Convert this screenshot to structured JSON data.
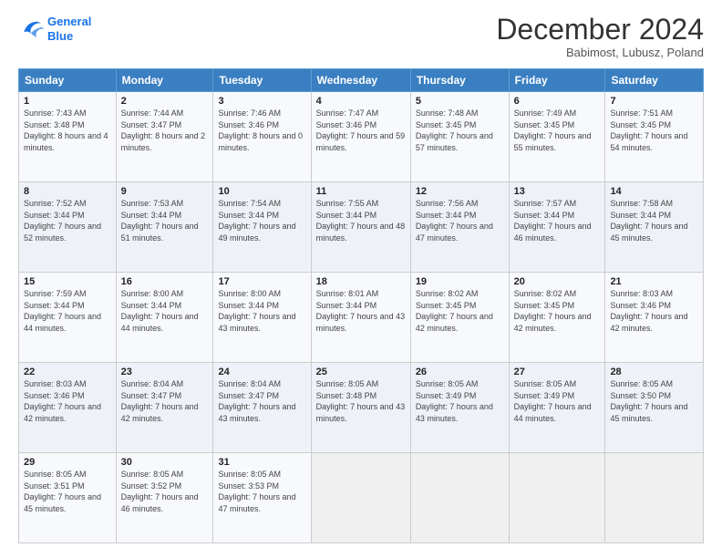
{
  "logo": {
    "line1": "General",
    "line2": "Blue"
  },
  "title": "December 2024",
  "location": "Babimost, Lubusz, Poland",
  "days_header": [
    "Sunday",
    "Monday",
    "Tuesday",
    "Wednesday",
    "Thursday",
    "Friday",
    "Saturday"
  ],
  "weeks": [
    [
      {
        "day": "1",
        "sunrise": "Sunrise: 7:43 AM",
        "sunset": "Sunset: 3:48 PM",
        "daylight": "Daylight: 8 hours and 4 minutes."
      },
      {
        "day": "2",
        "sunrise": "Sunrise: 7:44 AM",
        "sunset": "Sunset: 3:47 PM",
        "daylight": "Daylight: 8 hours and 2 minutes."
      },
      {
        "day": "3",
        "sunrise": "Sunrise: 7:46 AM",
        "sunset": "Sunset: 3:46 PM",
        "daylight": "Daylight: 8 hours and 0 minutes."
      },
      {
        "day": "4",
        "sunrise": "Sunrise: 7:47 AM",
        "sunset": "Sunset: 3:46 PM",
        "daylight": "Daylight: 7 hours and 59 minutes."
      },
      {
        "day": "5",
        "sunrise": "Sunrise: 7:48 AM",
        "sunset": "Sunset: 3:45 PM",
        "daylight": "Daylight: 7 hours and 57 minutes."
      },
      {
        "day": "6",
        "sunrise": "Sunrise: 7:49 AM",
        "sunset": "Sunset: 3:45 PM",
        "daylight": "Daylight: 7 hours and 55 minutes."
      },
      {
        "day": "7",
        "sunrise": "Sunrise: 7:51 AM",
        "sunset": "Sunset: 3:45 PM",
        "daylight": "Daylight: 7 hours and 54 minutes."
      }
    ],
    [
      {
        "day": "8",
        "sunrise": "Sunrise: 7:52 AM",
        "sunset": "Sunset: 3:44 PM",
        "daylight": "Daylight: 7 hours and 52 minutes."
      },
      {
        "day": "9",
        "sunrise": "Sunrise: 7:53 AM",
        "sunset": "Sunset: 3:44 PM",
        "daylight": "Daylight: 7 hours and 51 minutes."
      },
      {
        "day": "10",
        "sunrise": "Sunrise: 7:54 AM",
        "sunset": "Sunset: 3:44 PM",
        "daylight": "Daylight: 7 hours and 49 minutes."
      },
      {
        "day": "11",
        "sunrise": "Sunrise: 7:55 AM",
        "sunset": "Sunset: 3:44 PM",
        "daylight": "Daylight: 7 hours and 48 minutes."
      },
      {
        "day": "12",
        "sunrise": "Sunrise: 7:56 AM",
        "sunset": "Sunset: 3:44 PM",
        "daylight": "Daylight: 7 hours and 47 minutes."
      },
      {
        "day": "13",
        "sunrise": "Sunrise: 7:57 AM",
        "sunset": "Sunset: 3:44 PM",
        "daylight": "Daylight: 7 hours and 46 minutes."
      },
      {
        "day": "14",
        "sunrise": "Sunrise: 7:58 AM",
        "sunset": "Sunset: 3:44 PM",
        "daylight": "Daylight: 7 hours and 45 minutes."
      }
    ],
    [
      {
        "day": "15",
        "sunrise": "Sunrise: 7:59 AM",
        "sunset": "Sunset: 3:44 PM",
        "daylight": "Daylight: 7 hours and 44 minutes."
      },
      {
        "day": "16",
        "sunrise": "Sunrise: 8:00 AM",
        "sunset": "Sunset: 3:44 PM",
        "daylight": "Daylight: 7 hours and 44 minutes."
      },
      {
        "day": "17",
        "sunrise": "Sunrise: 8:00 AM",
        "sunset": "Sunset: 3:44 PM",
        "daylight": "Daylight: 7 hours and 43 minutes."
      },
      {
        "day": "18",
        "sunrise": "Sunrise: 8:01 AM",
        "sunset": "Sunset: 3:44 PM",
        "daylight": "Daylight: 7 hours and 43 minutes."
      },
      {
        "day": "19",
        "sunrise": "Sunrise: 8:02 AM",
        "sunset": "Sunset: 3:45 PM",
        "daylight": "Daylight: 7 hours and 42 minutes."
      },
      {
        "day": "20",
        "sunrise": "Sunrise: 8:02 AM",
        "sunset": "Sunset: 3:45 PM",
        "daylight": "Daylight: 7 hours and 42 minutes."
      },
      {
        "day": "21",
        "sunrise": "Sunrise: 8:03 AM",
        "sunset": "Sunset: 3:46 PM",
        "daylight": "Daylight: 7 hours and 42 minutes."
      }
    ],
    [
      {
        "day": "22",
        "sunrise": "Sunrise: 8:03 AM",
        "sunset": "Sunset: 3:46 PM",
        "daylight": "Daylight: 7 hours and 42 minutes."
      },
      {
        "day": "23",
        "sunrise": "Sunrise: 8:04 AM",
        "sunset": "Sunset: 3:47 PM",
        "daylight": "Daylight: 7 hours and 42 minutes."
      },
      {
        "day": "24",
        "sunrise": "Sunrise: 8:04 AM",
        "sunset": "Sunset: 3:47 PM",
        "daylight": "Daylight: 7 hours and 43 minutes."
      },
      {
        "day": "25",
        "sunrise": "Sunrise: 8:05 AM",
        "sunset": "Sunset: 3:48 PM",
        "daylight": "Daylight: 7 hours and 43 minutes."
      },
      {
        "day": "26",
        "sunrise": "Sunrise: 8:05 AM",
        "sunset": "Sunset: 3:49 PM",
        "daylight": "Daylight: 7 hours and 43 minutes."
      },
      {
        "day": "27",
        "sunrise": "Sunrise: 8:05 AM",
        "sunset": "Sunset: 3:49 PM",
        "daylight": "Daylight: 7 hours and 44 minutes."
      },
      {
        "day": "28",
        "sunrise": "Sunrise: 8:05 AM",
        "sunset": "Sunset: 3:50 PM",
        "daylight": "Daylight: 7 hours and 45 minutes."
      }
    ],
    [
      {
        "day": "29",
        "sunrise": "Sunrise: 8:05 AM",
        "sunset": "Sunset: 3:51 PM",
        "daylight": "Daylight: 7 hours and 45 minutes."
      },
      {
        "day": "30",
        "sunrise": "Sunrise: 8:05 AM",
        "sunset": "Sunset: 3:52 PM",
        "daylight": "Daylight: 7 hours and 46 minutes."
      },
      {
        "day": "31",
        "sunrise": "Sunrise: 8:05 AM",
        "sunset": "Sunset: 3:53 PM",
        "daylight": "Daylight: 7 hours and 47 minutes."
      },
      null,
      null,
      null,
      null
    ]
  ]
}
